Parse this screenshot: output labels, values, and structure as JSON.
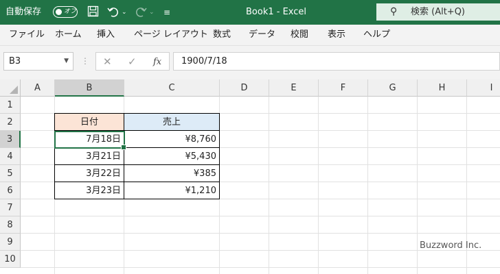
{
  "titlebar": {
    "autosave_label": "自動保存",
    "autosave_state": "オフ",
    "title": "Book1  -  Excel",
    "search_placeholder": "検索 (Alt+Q)",
    "icons": [
      "save-icon",
      "undo-icon",
      "redo-icon",
      "customize-qat-icon",
      "search-icon"
    ]
  },
  "ribbon": {
    "tabs": [
      "ファイル",
      "ホーム",
      "挿入",
      "ページ レイアウト",
      "数式",
      "データ",
      "校閲",
      "表示",
      "ヘルプ"
    ]
  },
  "formula_bar": {
    "name_box": "B3",
    "fx_label": "fx",
    "formula": "1900/7/18"
  },
  "sheet": {
    "columns": [
      "A",
      "B",
      "C",
      "D",
      "E",
      "F",
      "G",
      "H",
      "I"
    ],
    "rows": [
      "1",
      "2",
      "3",
      "4",
      "5",
      "6",
      "7",
      "8",
      "9",
      "10"
    ],
    "selected_cell": "B3",
    "table": {
      "headers": [
        "日付",
        "売上"
      ],
      "header_colors": [
        "#fce4d6",
        "#ddebf7"
      ],
      "rows": [
        [
          "7月18日",
          "¥8,760"
        ],
        [
          "3月21日",
          "¥5,430"
        ],
        [
          "3月22日",
          "¥385"
        ],
        [
          "3月23日",
          "¥1,210"
        ]
      ]
    }
  },
  "watermark": "Buzzword Inc.",
  "colors": {
    "accent": "#217346"
  }
}
